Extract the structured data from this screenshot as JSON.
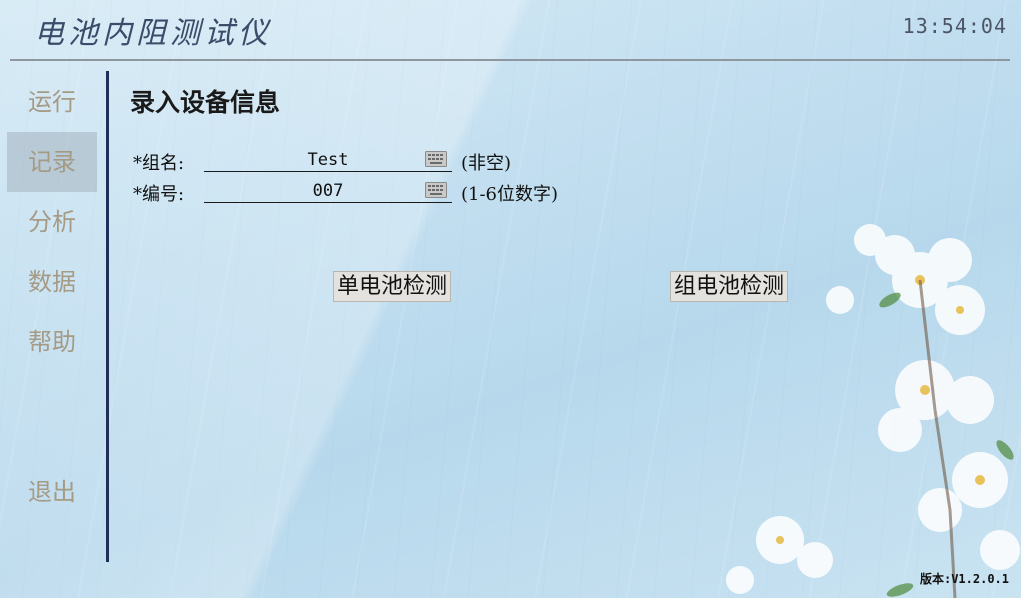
{
  "app": {
    "title": "电池内阻测试仪",
    "clock": "13:54:04",
    "version": "版本:V1.2.0.1"
  },
  "sidebar": {
    "items": [
      {
        "label": "运行"
      },
      {
        "label": "记录"
      },
      {
        "label": "分析"
      },
      {
        "label": "数据"
      },
      {
        "label": "帮助"
      }
    ],
    "exit_label": "退出",
    "active_index": 1
  },
  "main": {
    "heading": "录入设备信息",
    "fields": [
      {
        "label": "*组名:",
        "value": "Test",
        "hint": "(非空)"
      },
      {
        "label": "*编号:",
        "value": "007",
        "hint": "(1-6位数字)"
      }
    ],
    "buttons": {
      "single": "单电池检测",
      "group": "组电池检测"
    }
  },
  "colors": {
    "accent_bar": "#1f2f57",
    "nav_text": "#a59a84",
    "title_text": "#3b4c6a"
  }
}
